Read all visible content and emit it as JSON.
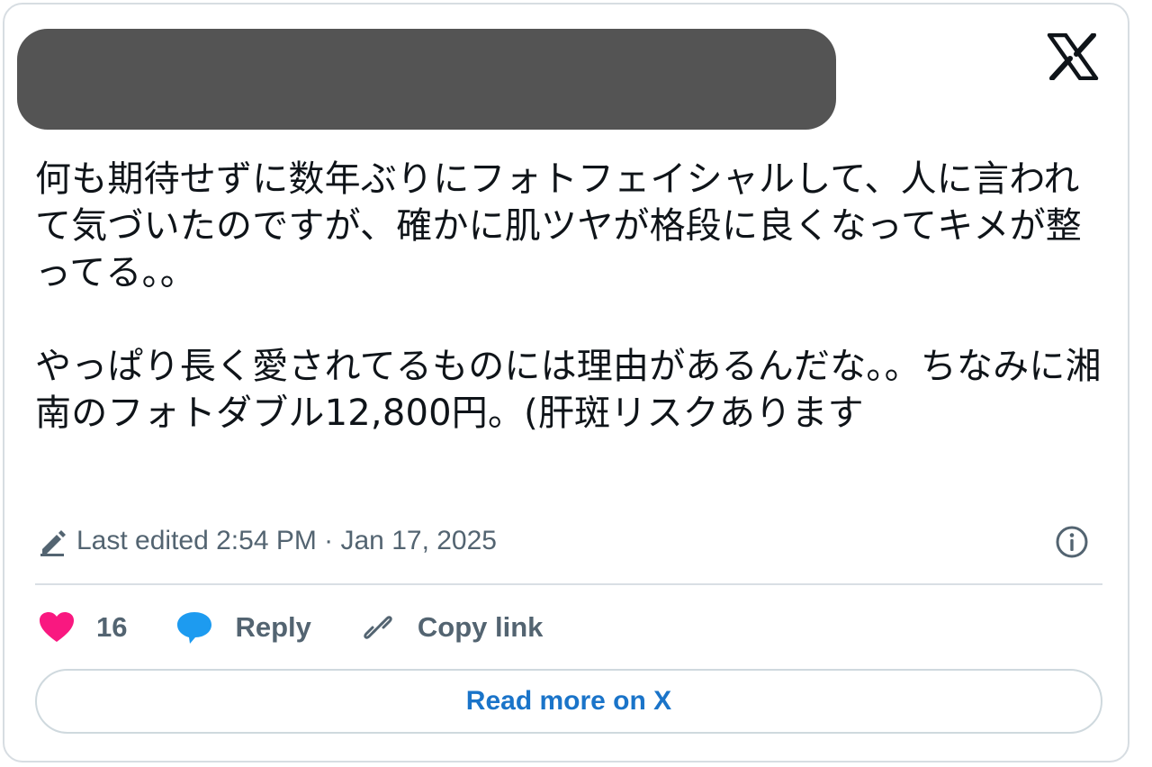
{
  "tweet": {
    "text": "何も期待せずに数年ぶりにフォトフェイシャルして、人に言われて気づいたのですが、確かに肌ツヤが格段に良くなってキメが整ってる。。\n\nやっぱり長く愛されてるものには理由があるんだな。。ちなみに湘南のフォトダブル12,800円。(肝斑リスクあります"
  },
  "meta": {
    "edited": "Last edited 2:54 PM · Jan 17, 2025"
  },
  "actions": {
    "likes": "16",
    "reply_label": "Reply",
    "copy_label": "Copy link"
  },
  "read_more_label": "Read more on X",
  "colors": {
    "heart": "#f91880",
    "reply_bubble": "#1d9bf0",
    "link_blue": "#1a74c9",
    "muted": "#536471",
    "redaction": "#545454"
  },
  "icons": [
    "x-logo-icon",
    "pencil-icon",
    "info-icon",
    "heart-icon",
    "reply-bubble-icon",
    "link-icon"
  ]
}
